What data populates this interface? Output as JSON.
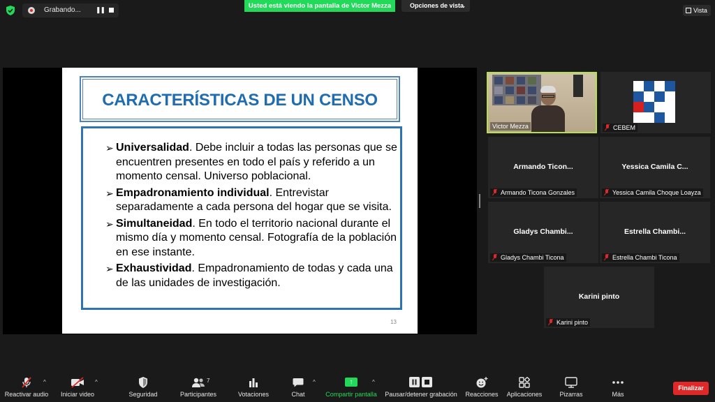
{
  "topbar": {
    "recording_label": "Grabando...",
    "pause_glyph": "❚❚",
    "sharing_banner": "Usted está viendo la pantalla de Victor Mezza",
    "view_options": "Opciones de vista",
    "view_options_chevron": "⌄",
    "view_button": "Vista"
  },
  "slide": {
    "title": "CARACTERÍSTICAS DE UN CENSO",
    "arrow_glyph": "➢",
    "bullets": [
      {
        "term": "Universalidad",
        "text": ". Debe incluir a todas las personas que se encuentren presentes en todo el país y referido a un momento censal. Universo poblacional."
      },
      {
        "term": "Empadronamiento individual",
        "text": ". Entrevistar separadamente a cada persona del hogar que se visita."
      },
      {
        "term": "Simultaneidad",
        "text": ". En todo el territorio nacional durante el mismo día y momento censal. Fotografía de la población en ese instante."
      },
      {
        "term": "Exhaustividad",
        "text": ". Empadronamiento de todas y cada una de las unidades de investigación."
      }
    ],
    "page_number": "13"
  },
  "participants": [
    {
      "label": "Victor Mezza",
      "display_name": "",
      "active_speaker": true,
      "has_video": true
    },
    {
      "label": "CEBEM",
      "display_name": "",
      "has_logo": true
    },
    {
      "label": "Armando Ticona Gonzales",
      "display_name": "Armando  Ticon..."
    },
    {
      "label": "Yessica Camila Choque Loayza",
      "display_name": "Yessica  Camila  C..."
    },
    {
      "label": "Gladys Chambi Ticona",
      "display_name": "Gladys  Chambi..."
    },
    {
      "label": "Estrella Chambi Ticona",
      "display_name": "Estrella  Chambi..."
    },
    {
      "label": "Karini pinto",
      "display_name": "Karini pinto"
    }
  ],
  "toolbar": {
    "unmute": "Reactivar audio",
    "start_video": "Iniciar video",
    "security": "Seguridad",
    "participants": "Participantes",
    "participants_count": "7",
    "polls": "Votaciones",
    "chat": "Chat",
    "share_screen": "Compartir pantalla",
    "pause_record": "Pausar/detener grabación",
    "reactions": "Reacciones",
    "apps": "Aplicaciones",
    "whiteboards": "Pizarras",
    "more": "Más",
    "end": "Finalizar",
    "caret": "^"
  },
  "icons": {
    "shield": "shield-check-icon",
    "mic": "mic-muted-icon",
    "video": "video-off-icon",
    "security": "shield-icon",
    "participants": "people-icon",
    "polls": "bar-chart-icon",
    "chat": "speech-bubble-icon",
    "share": "share-screen-icon",
    "record": "pause-stop-icon",
    "reactions": "smiley-plus-icon",
    "apps": "apps-icon",
    "whiteboards": "whiteboard-icon",
    "more": "more-dots-icon"
  },
  "colors": {
    "banner_green": "#23d959",
    "end_red": "#e02828",
    "speaker_border": "#b7e04a",
    "slide_blue": "#1f6cb0"
  }
}
